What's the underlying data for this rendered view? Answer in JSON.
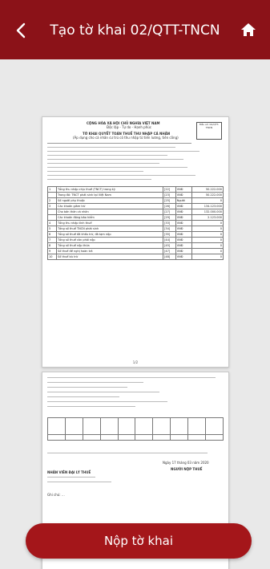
{
  "header": {
    "title": "Tạo tờ khai 02/QTT-TNCN",
    "back_icon": "back-chevron-icon",
    "home_icon": "home-icon",
    "bg_color": "#8b1218"
  },
  "document": {
    "p1_country": "CỘNG HÒA XÃ HỘI CHỦ NGHĨA VIỆT NAM",
    "p1_motto": "Độc lập - Tự do - Hạnh phúc",
    "p1_form_title": "TỜ KHAI QUYẾT TOÁN THUẾ THU NHẬP CÁ NHÂN",
    "p1_form_sub": "(Áp dụng cho cá nhân cư trú có thu nhập từ tiền lương, tiền công)",
    "p1_stamp": "Mẫu số: 02/QTT-TNCN",
    "p1_page": "1/2",
    "p2_date": "Ngày 17 tháng 03 năm 2020",
    "p2_signer": "NGƯỜI NỘP THUẾ",
    "p2_agent": "NHÂN VIÊN ĐẠI LÝ THUẾ",
    "p2_note": "Ghi chú: ...",
    "rows": [
      {
        "no": "1",
        "name": "Tổng thu nhập chịu thuế (TNCT) trong kỳ",
        "code": "[22]",
        "unit": "VNĐ",
        "value": "50.222.000"
      },
      {
        "no": "",
        "name": "Trong đó: TNCT phát sinh tại Việt Nam",
        "code": "[23]",
        "unit": "VNĐ",
        "value": "50.222.000"
      },
      {
        "no": "2",
        "name": "Số người phụ thuộc",
        "code": "[25]",
        "unit": "Người",
        "value": "0"
      },
      {
        "no": "3",
        "name": "Các khoản giảm trừ",
        "code": "[26]",
        "unit": "VNĐ",
        "value": "134.123.000"
      },
      {
        "no": "",
        "name": "Cho bản thân cá nhân",
        "code": "[27]",
        "unit": "VNĐ",
        "value": "132.000.000"
      },
      {
        "no": "",
        "name": "Các khoản đóng bảo hiểm",
        "code": "[29]",
        "unit": "VNĐ",
        "value": "2.123.000"
      },
      {
        "no": "4",
        "name": "Tổng thu nhập tính thuế",
        "code": "[33]",
        "unit": "VNĐ",
        "value": "0"
      },
      {
        "no": "5",
        "name": "Tổng số thuế TNCN phát sinh",
        "code": "[34]",
        "unit": "VNĐ",
        "value": "0"
      },
      {
        "no": "6",
        "name": "Tổng số thuế đã khấu trừ, đã tạm nộp",
        "code": "[35]",
        "unit": "VNĐ",
        "value": "0"
      },
      {
        "no": "7",
        "name": "Tổng số thuế còn phải nộp",
        "code": "[44]",
        "unit": "VNĐ",
        "value": "0"
      },
      {
        "no": "8",
        "name": "Tổng số thuế nộp thừa",
        "code": "[45]",
        "unit": "VNĐ",
        "value": "0"
      },
      {
        "no": "9",
        "name": "Số thuế đề nghị hoàn trả",
        "code": "[47]",
        "unit": "VNĐ",
        "value": "0"
      },
      {
        "no": "10",
        "name": "Số thuế bù trừ",
        "code": "[48]",
        "unit": "VNĐ",
        "value": "0"
      }
    ]
  },
  "footer": {
    "submit_label": "Nộp tờ khai",
    "button_color": "#a4161a"
  }
}
